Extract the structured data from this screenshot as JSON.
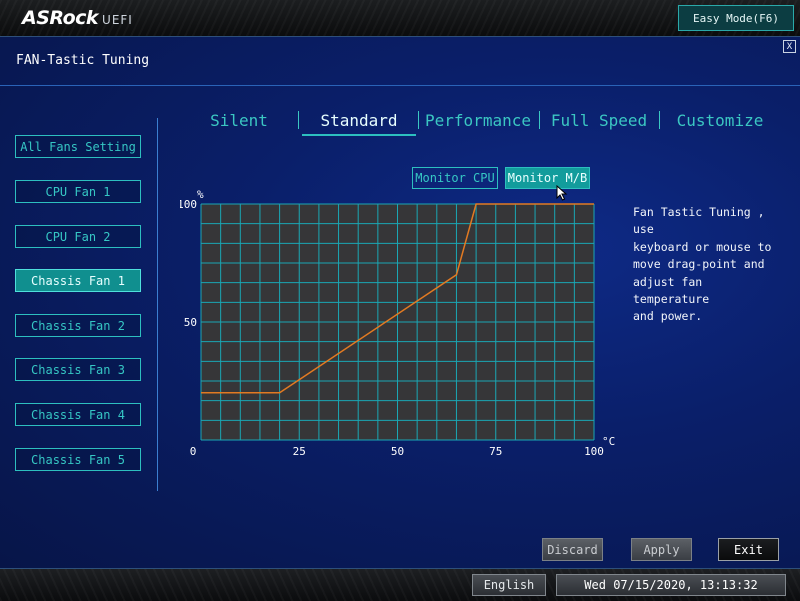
{
  "brand": {
    "name": "ASRock",
    "suffix": "UEFI"
  },
  "header": {
    "easy_mode_label": "Easy Mode(F6)",
    "close_label": "X"
  },
  "page": {
    "title": "FAN-Tastic Tuning"
  },
  "sidebar": {
    "items": [
      {
        "label": "All Fans Setting",
        "active": false
      },
      {
        "label": "CPU Fan 1",
        "active": false
      },
      {
        "label": "CPU Fan 2",
        "active": false
      },
      {
        "label": "Chassis Fan 1",
        "active": true
      },
      {
        "label": "Chassis Fan 2",
        "active": false
      },
      {
        "label": "Chassis Fan 3",
        "active": false
      },
      {
        "label": "Chassis Fan 4",
        "active": false
      },
      {
        "label": "Chassis Fan 5",
        "active": false
      }
    ]
  },
  "tabs": [
    {
      "label": "Silent",
      "active": false
    },
    {
      "label": "Standard",
      "active": true
    },
    {
      "label": "Performance",
      "active": false
    },
    {
      "label": "Full Speed",
      "active": false
    },
    {
      "label": "Customize",
      "active": false
    }
  ],
  "monitor": {
    "cpu_label": "Monitor CPU",
    "mb_label": "Monitor M/B",
    "selected": "Monitor M/B"
  },
  "help_text": "Fan Tastic Tuning , use\nkeyboard or mouse to\nmove drag-point and\nadjust fan temperature\nand power.",
  "chart_data": {
    "type": "line",
    "y_unit": "%",
    "x_unit": "°C",
    "xlim": [
      0,
      100
    ],
    "ylim": [
      0,
      100
    ],
    "x_ticks": [
      "0",
      "25",
      "50",
      "75",
      "100"
    ],
    "y_ticks": [
      "100",
      "50"
    ],
    "grid": true,
    "series": [
      {
        "x": [
          0,
          20,
          65,
          70,
          100
        ],
        "y": [
          20,
          20,
          70,
          100,
          100
        ]
      }
    ],
    "line_color": "#e27a22"
  },
  "actions": {
    "discard": "Discard",
    "apply": "Apply",
    "exit": "Exit"
  },
  "footer": {
    "language": "English",
    "datetime": "Wed 07/15/2020, 13:13:32"
  }
}
